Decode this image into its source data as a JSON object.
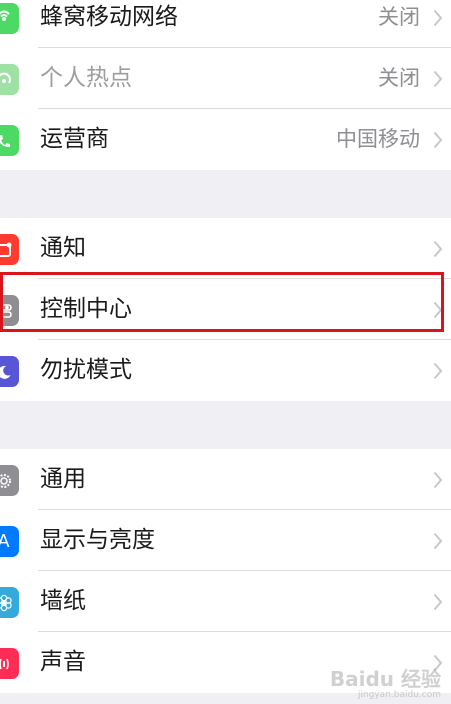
{
  "group1": {
    "rows": [
      {
        "label": "蜂窝移动网络",
        "value": "关闭",
        "icon": "cellular-icon",
        "color": "#4cd964"
      },
      {
        "label": "个人热点",
        "value": "关闭",
        "icon": "hotspot-icon",
        "color": "#9fe0a5"
      },
      {
        "label": "运营商",
        "value": "中国移动",
        "icon": "phone-icon",
        "color": "#4cd964"
      }
    ]
  },
  "group2": {
    "rows": [
      {
        "label": "通知",
        "icon": "notifications-icon",
        "color": "#ff3b30"
      },
      {
        "label": "控制中心",
        "icon": "control-center-icon",
        "color": "#8e8e93"
      },
      {
        "label": "勿扰模式",
        "icon": "moon-icon",
        "color": "#5856d6"
      }
    ]
  },
  "group3": {
    "rows": [
      {
        "label": "通用",
        "icon": "gear-icon",
        "color": "#8e8e93"
      },
      {
        "label": "显示与亮度",
        "icon": "display-icon",
        "color": "#007aff",
        "glyph": "A"
      },
      {
        "label": "墙纸",
        "icon": "wallpaper-icon",
        "color": "#34aadc"
      },
      {
        "label": "声音",
        "icon": "sound-icon",
        "color": "#ff2d55"
      }
    ]
  },
  "watermark": {
    "text": "Baidu 经验",
    "sub": "jingyan.baidu.com"
  },
  "colors": {
    "highlight": "#d9141b",
    "background": "#efeff4"
  }
}
